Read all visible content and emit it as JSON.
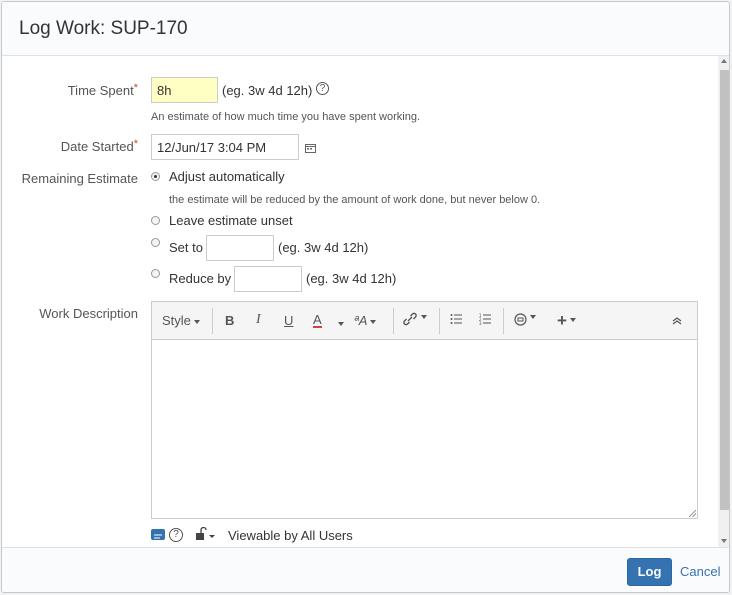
{
  "dialog": {
    "title": "Log Work: SUP-170"
  },
  "form": {
    "time_spent": {
      "label": "Time Spent",
      "required_mark": "*",
      "value": "8h",
      "hint": "(eg. 3w 4d 12h)",
      "description": "An estimate of how much time you have spent working."
    },
    "date_started": {
      "label": "Date Started",
      "required_mark": "*",
      "value": "12/Jun/17 3:04 PM"
    },
    "remaining_estimate": {
      "label": "Remaining Estimate",
      "options": {
        "adjust": {
          "label": "Adjust automatically",
          "description": "the estimate will be reduced by the amount of work done, but never below 0.",
          "checked": true
        },
        "unset": {
          "label": "Leave estimate unset"
        },
        "set_to": {
          "label": "Set to",
          "hint": "(eg. 3w 4d 12h)",
          "value": ""
        },
        "reduce_by": {
          "label": "Reduce by",
          "hint": "(eg. 3w 4d 12h)",
          "value": ""
        }
      }
    },
    "work_description": {
      "label": "Work Description"
    }
  },
  "editor": {
    "toolbar": {
      "style": "Style",
      "bold": "B",
      "italic": "I",
      "underline": "U",
      "color": "A",
      "text_effects": "ªA"
    },
    "visibility": "Viewable by All Users"
  },
  "footer": {
    "log": "Log",
    "cancel": "Cancel"
  },
  "colors": {
    "primary": "#3572b0",
    "required": "#d04437",
    "highlight": "#ffffc4",
    "underline_red": "#d04437"
  }
}
